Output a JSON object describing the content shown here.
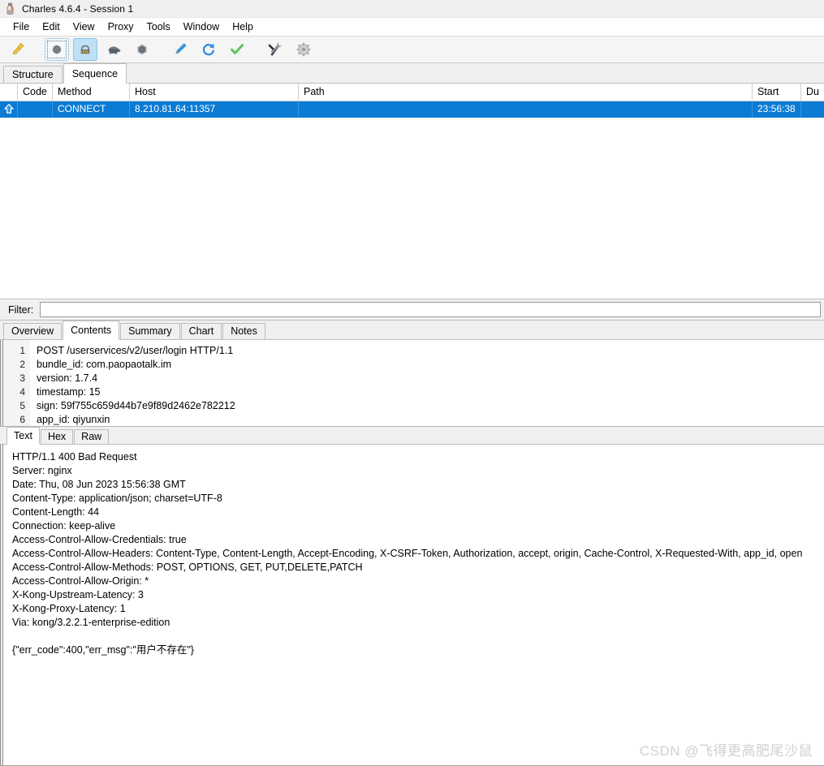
{
  "window": {
    "title": "Charles 4.6.4 - Session 1",
    "app_icon": "charles-bottle-icon"
  },
  "menu": {
    "items": [
      {
        "label": "File"
      },
      {
        "label": "Edit"
      },
      {
        "label": "View"
      },
      {
        "label": "Proxy"
      },
      {
        "label": "Tools"
      },
      {
        "label": "Window"
      },
      {
        "label": "Help"
      }
    ]
  },
  "toolbar": {
    "buttons": [
      {
        "name": "clear-session-button",
        "icon": "broom-icon",
        "state": "normal"
      },
      {
        "name": "start-recording-button",
        "icon": "record-circle-icon",
        "state": "focused"
      },
      {
        "name": "throttling-button",
        "icon": "road-barrier-icon",
        "state": "active"
      },
      {
        "name": "breakpoints-button",
        "icon": "turtle-icon",
        "state": "normal"
      },
      {
        "name": "stop-button",
        "icon": "hexagon-stop-icon",
        "state": "normal"
      },
      {
        "name": "compose-button",
        "icon": "pen-icon",
        "state": "normal"
      },
      {
        "name": "repeat-button",
        "icon": "refresh-arrow-icon",
        "state": "normal"
      },
      {
        "name": "validate-button",
        "icon": "green-check-icon",
        "state": "normal"
      },
      {
        "name": "tools-button",
        "icon": "hammer-wrench-icon",
        "state": "normal"
      },
      {
        "name": "settings-button",
        "icon": "gear-icon",
        "state": "normal"
      }
    ]
  },
  "session_tabs": {
    "items": [
      {
        "label": "Structure",
        "selected": false
      },
      {
        "label": "Sequence",
        "selected": true
      }
    ]
  },
  "request_table": {
    "columns": [
      {
        "key": "icon",
        "label": ""
      },
      {
        "key": "code",
        "label": "Code"
      },
      {
        "key": "method",
        "label": "Method"
      },
      {
        "key": "host",
        "label": "Host"
      },
      {
        "key": "path",
        "label": "Path"
      },
      {
        "key": "start",
        "label": "Start"
      },
      {
        "key": "dur",
        "label": "Du"
      }
    ],
    "rows": [
      {
        "icon": "up-arrow-icon",
        "code": "",
        "method": "CONNECT",
        "host": "8.210.81.64:11357",
        "path": "",
        "start": "23:56:38",
        "dur": "",
        "selected": true
      }
    ]
  },
  "filter": {
    "label": "Filter:",
    "value": "",
    "placeholder": ""
  },
  "detail_tabs": {
    "items": [
      {
        "label": "Overview",
        "selected": false
      },
      {
        "label": "Contents",
        "selected": true
      },
      {
        "label": "Summary",
        "selected": false
      },
      {
        "label": "Chart",
        "selected": false
      },
      {
        "label": "Notes",
        "selected": false
      }
    ]
  },
  "request_content": {
    "line_numbers": [
      "1",
      "2",
      "3",
      "4",
      "5",
      "6"
    ],
    "lines": [
      "POST /userservices/v2/user/login HTTP/1.1",
      "bundle_id: com.paopaotalk.im",
      "version: 1.7.4",
      "timestamp: 15",
      "sign: 59f755c659d44b7e9f89d2462e782212",
      "app_id: qiyunxin"
    ]
  },
  "view_tabs": {
    "items": [
      {
        "label": "Text",
        "selected": true
      },
      {
        "label": "Hex",
        "selected": false
      },
      {
        "label": "Raw",
        "selected": false
      }
    ]
  },
  "response_content": {
    "lines": [
      "HTTP/1.1 400 Bad Request",
      "Server: nginx",
      "Date: Thu, 08 Jun 2023 15:56:38 GMT",
      "Content-Type: application/json; charset=UTF-8",
      "Content-Length: 44",
      "Connection: keep-alive",
      "Access-Control-Allow-Credentials: true",
      "Access-Control-Allow-Headers: Content-Type, Content-Length, Accept-Encoding, X-CSRF-Token, Authorization, accept, origin, Cache-Control, X-Requested-With, app_id, open",
      "Access-Control-Allow-Methods: POST, OPTIONS, GET, PUT,DELETE,PATCH",
      "Access-Control-Allow-Origin: *",
      "X-Kong-Upstream-Latency: 3",
      "X-Kong-Proxy-Latency: 1",
      "Via: kong/3.2.2.1-enterprise-edition",
      "",
      "{\"err_code\":400,\"err_msg\":\"用户不存在\"}"
    ]
  },
  "watermark": {
    "text": "CSDN @飞得更高肥尾沙鼠"
  },
  "colors": {
    "selection_blue": "#0b7bd4",
    "toolbar_active": "#bfe0f7",
    "window_bg": "#f0f0f0",
    "pane_bg": "#ffffff",
    "watermark": "#d0d0d0"
  }
}
